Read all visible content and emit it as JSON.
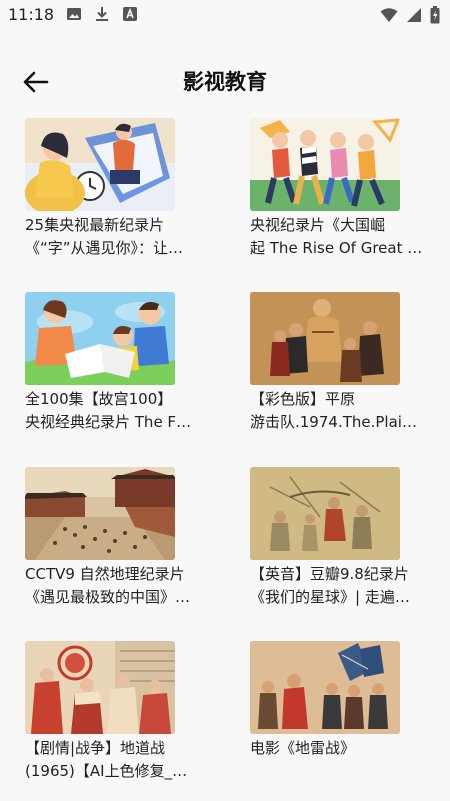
{
  "status_bar": {
    "time": "11:18",
    "left_icons": [
      "image-icon",
      "download-icon",
      "a-icon"
    ],
    "right_icons": [
      "wifi-icon",
      "signal-icon",
      "battery-icon"
    ]
  },
  "header": {
    "title": "影视教育",
    "back_icon": "arrow-left-icon"
  },
  "videos": [
    {
      "line1": "25集央视最新纪录片",
      "line2": "《“字”从遇见你》：让…"
    },
    {
      "line1": "央视纪录片《大国崛",
      "line2": "起 The Rise Of Great N…"
    },
    {
      "line1": "全100集【故宫100】",
      "line2": "央视经典纪录片 The F…"
    },
    {
      "line1": "【彩色版】平原",
      "line2": "游击队.1974.The.Plain…"
    },
    {
      "line1": "CCTV9 自然地理纪录片",
      "line2": "《遇见最极致的中国》…"
    },
    {
      "line1": "【英音】豆瓣9.8纪录片",
      "line2": "《我们的星球》| 走遍…"
    },
    {
      "line1": "【剧情|战争】地道战",
      "line2": "(1965)【AI上色修复_…"
    },
    {
      "line1": "电影《地雷战》",
      "line2": ""
    }
  ]
}
